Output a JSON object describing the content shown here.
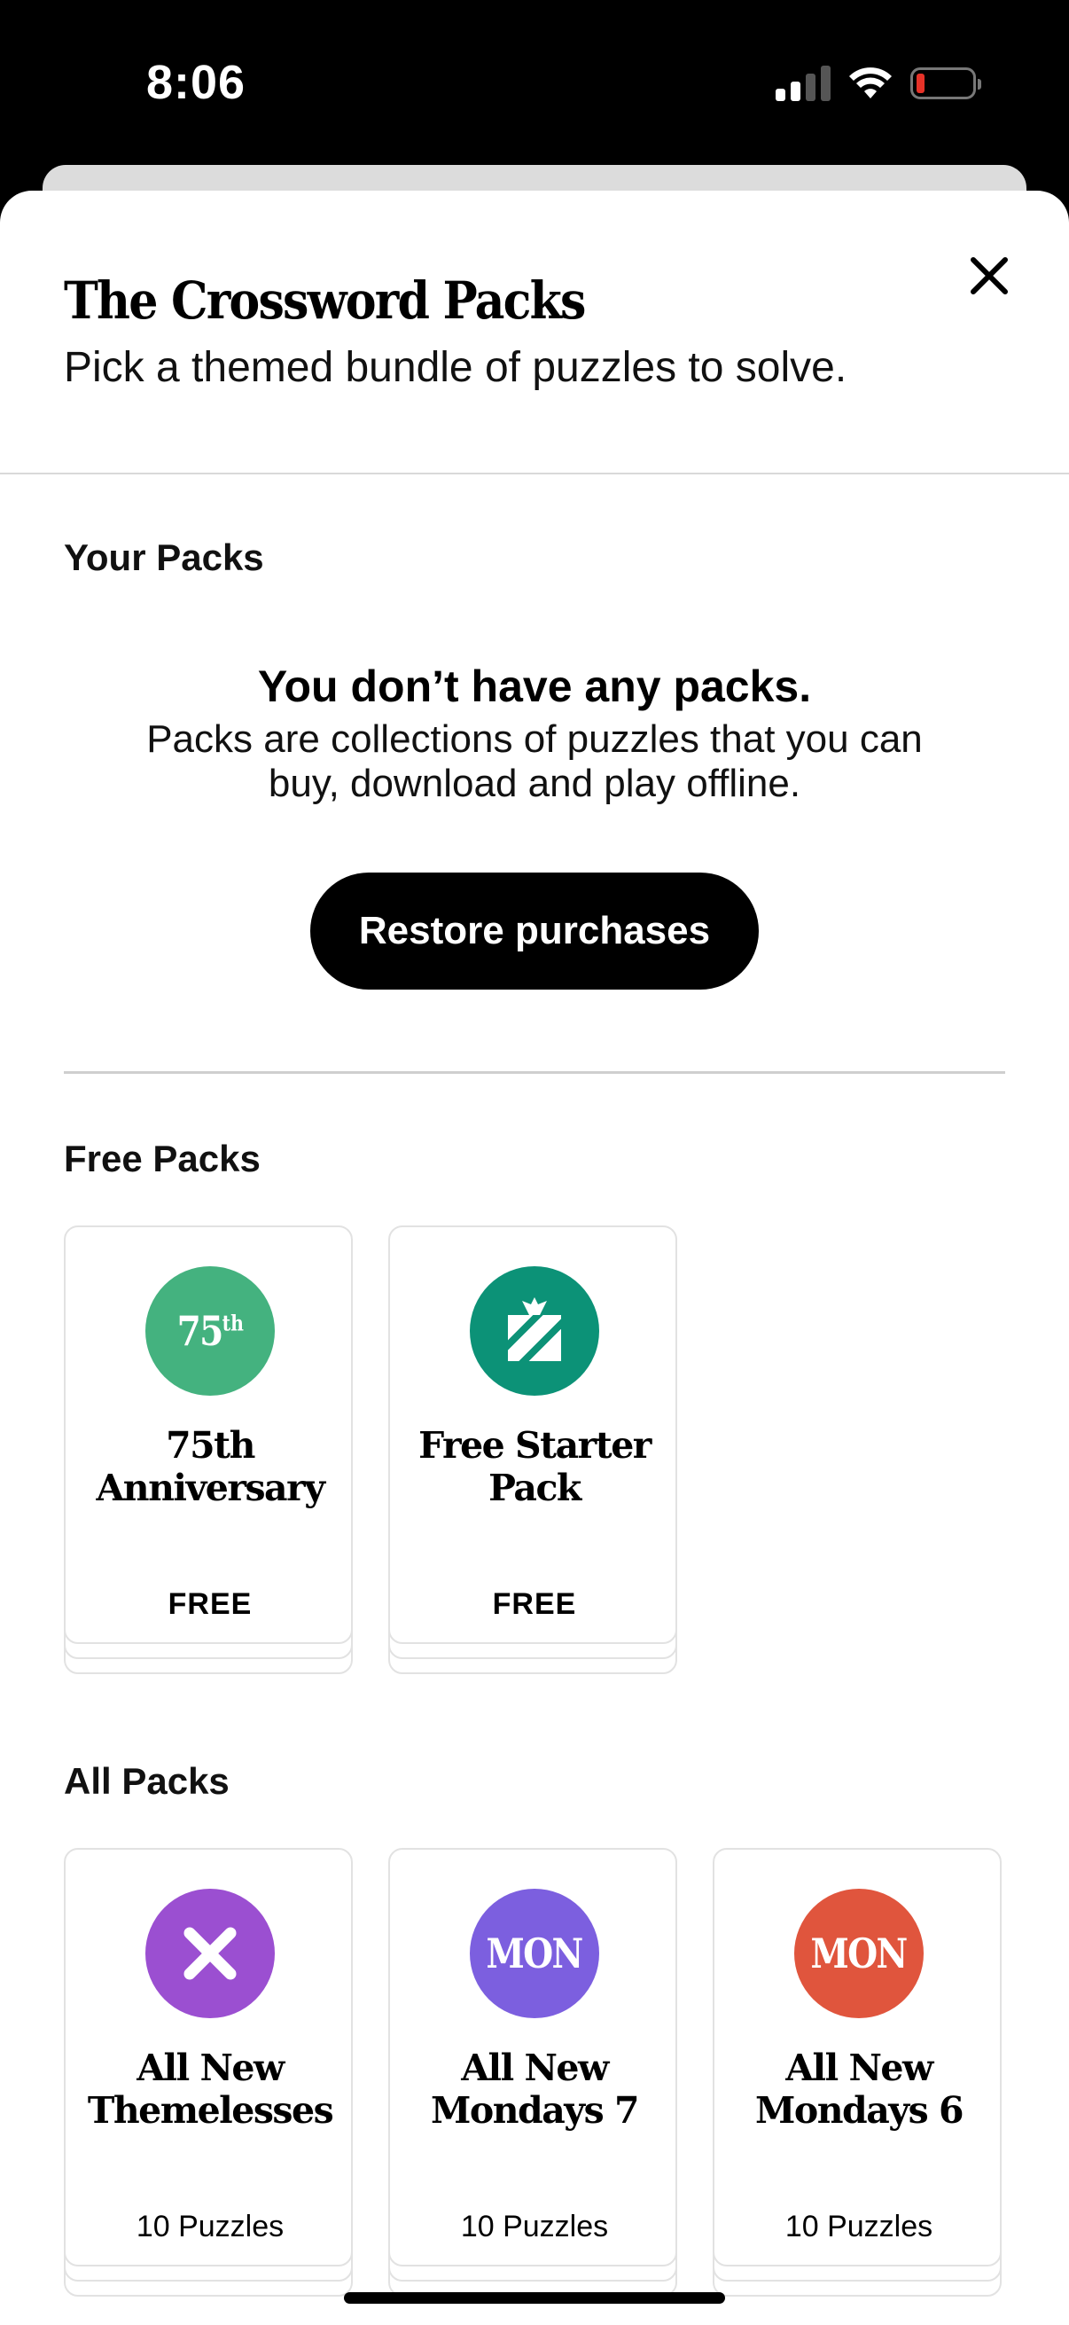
{
  "status_bar": {
    "time": "8:06"
  },
  "header": {
    "title": "The Crossword Packs",
    "subtitle": "Pick a themed bundle of puzzles to solve."
  },
  "your_packs": {
    "section_title": "Your Packs",
    "empty_title": "You don’t have any packs.",
    "empty_body": "Packs are collections of puzzles that you can buy, download and play offline.",
    "restore_label": "Restore purchases"
  },
  "free_packs": {
    "section_title": "Free Packs",
    "items": [
      {
        "icon": "75th-anniversary-icon",
        "icon_text": "75",
        "icon_sup": "th",
        "color": "#44b27f",
        "title_line1": "75th",
        "title_line2": "Anniversary",
        "price": "FREE"
      },
      {
        "icon": "gift-icon",
        "color": "#0c9277",
        "title_line1": "Free Starter",
        "title_line2": "Pack",
        "price": "FREE"
      }
    ]
  },
  "all_packs": {
    "section_title": "All Packs",
    "items": [
      {
        "icon": "x-icon",
        "color": "#9b4fd1",
        "title_line1": "All New",
        "title_line2": "Themelesses",
        "price": "10 Puzzles"
      },
      {
        "icon": "mon-icon",
        "icon_text": "MON",
        "color": "#7c5fdf",
        "title_line1": "All New",
        "title_line2": "Mondays 7",
        "price": "10 Puzzles"
      },
      {
        "icon": "mon-icon",
        "icon_text": "MON",
        "color": "#e0553d",
        "title_line1": "All New",
        "title_line2": "Mondays 6",
        "price": "10 Puzzles"
      }
    ]
  }
}
